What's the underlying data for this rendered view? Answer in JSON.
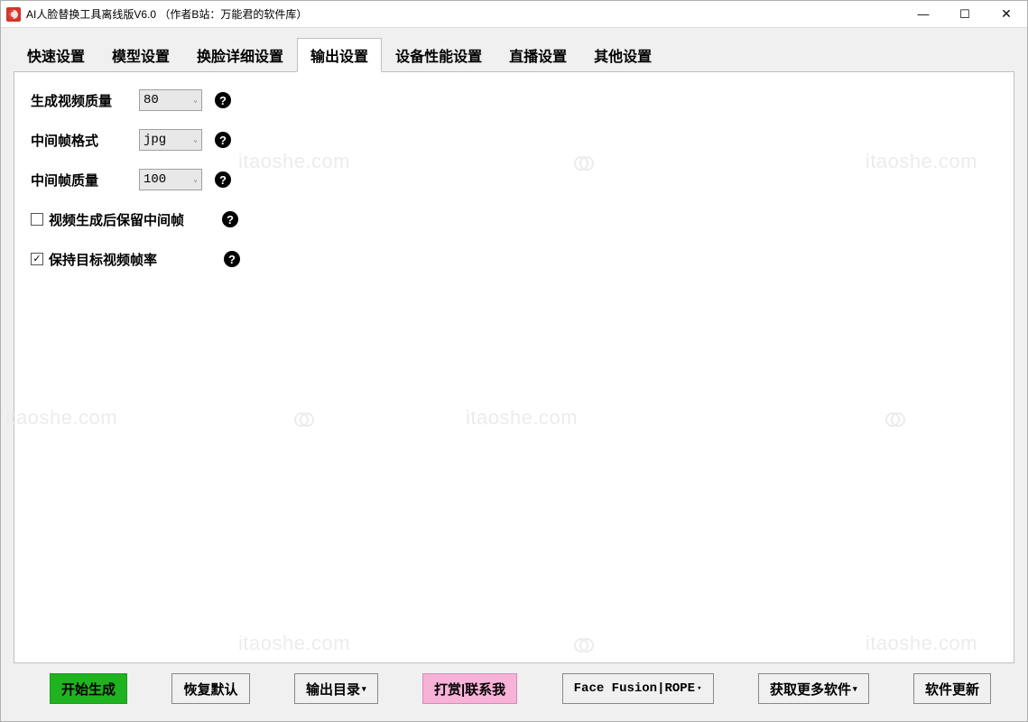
{
  "window": {
    "title": "AI人脸替换工具离线版V6.0 （作者B站：万能君的软件库）"
  },
  "tabs": [
    {
      "label": "快速设置",
      "active": false
    },
    {
      "label": "模型设置",
      "active": false
    },
    {
      "label": "换脸详细设置",
      "active": false
    },
    {
      "label": "输出设置",
      "active": true
    },
    {
      "label": "设备性能设置",
      "active": false
    },
    {
      "label": "直播设置",
      "active": false
    },
    {
      "label": "其他设置",
      "active": false
    }
  ],
  "form": {
    "video_quality": {
      "label": "生成视频质量",
      "value": "80"
    },
    "frame_format": {
      "label": "中间帧格式",
      "value": "jpg"
    },
    "frame_quality": {
      "label": "中间帧质量",
      "value": "100"
    },
    "keep_frames": {
      "label": "视频生成后保留中间帧",
      "checked": false
    },
    "keep_fps": {
      "label": "保持目标视频帧率",
      "checked": true
    }
  },
  "buttons": {
    "start": "开始生成",
    "reset": "恢复默认",
    "output_dir": "输出目录",
    "donate": "打赏|联系我",
    "facefusion": "Face Fusion|ROPE",
    "more_soft": "获取更多软件",
    "update": "软件更新"
  },
  "watermark": "itaoshe.com"
}
